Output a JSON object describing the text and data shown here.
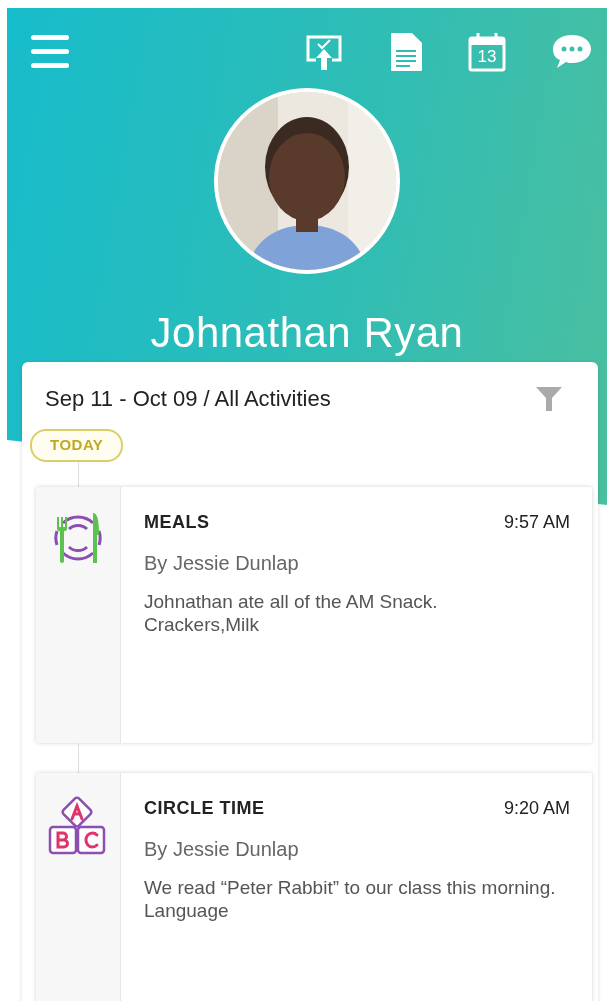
{
  "header": {
    "calendar_day": "13",
    "child_name": "Johnathan Ryan"
  },
  "filter": {
    "label": "Sep 11 - Oct 09 / All Activities"
  },
  "timeline": {
    "badge": "TODAY",
    "entries": [
      {
        "kind": "meals",
        "title": "MEALS",
        "time": "9:57 AM",
        "by": "By Jessie Dunlap",
        "lines": [
          "Johnathan ate all of the AM Snack.",
          "Crackers,Milk"
        ]
      },
      {
        "kind": "circle_time",
        "title": "CIRCLE TIME",
        "time": "9:20 AM",
        "by": "By Jessie Dunlap",
        "lines": [
          "We read “Peter Rabbit” to our class this morning.",
          "Language"
        ]
      }
    ]
  }
}
